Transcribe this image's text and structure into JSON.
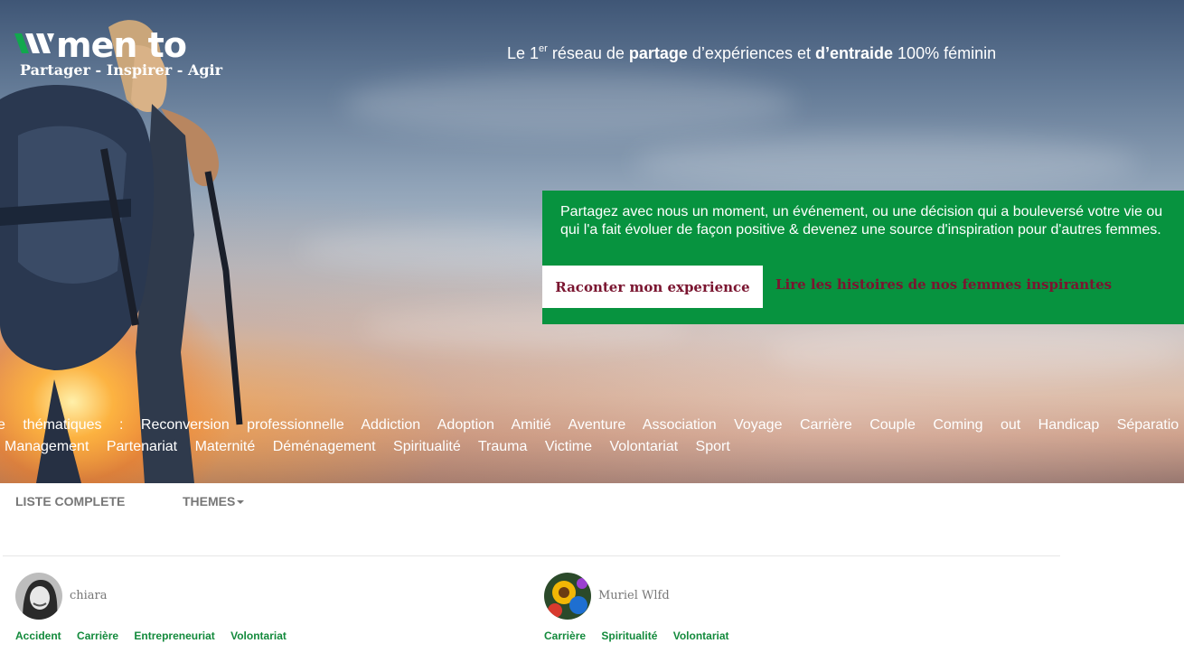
{
  "logo": {
    "wordmark": "men to",
    "tagline": "Partager - Inspirer - Agir"
  },
  "tagline": {
    "p1": "Le 1",
    "sup": "er",
    "p2": " réseau de ",
    "b1": "partage",
    "p3": " d’expériences et ",
    "b2": "d’entraide",
    "p4": " 100% féminin"
  },
  "cta": {
    "message": "Partagez avec nous un moment, un événement, ou une décision qui a bouleversé votre vie ou qui l'a fait évoluer de façon positive & devenez une source d'inspiration pour d'autres femmes.",
    "share_button": "Raconter mon experience",
    "read_link": "Lire les histoires de nos femmes inspirantes"
  },
  "themes_row1": [
    "e",
    "thématiques",
    ":",
    "Reconversion",
    "professionnelle",
    "Addiction",
    "Adoption",
    "Amitié",
    "Aventure",
    "Association",
    "Voyage",
    "Carrière",
    "Couple",
    "Coming",
    "out",
    "Handicap",
    "Séparatio"
  ],
  "themes_row2": [
    "Management",
    "Partenariat",
    "Maternité",
    "Déménagement",
    "Spiritualité",
    "Trauma",
    "Victime",
    "Volontariat",
    "Sport"
  ],
  "tabs": {
    "full_list": "LISTE COMPLETE",
    "themes": "THEMES"
  },
  "stories": [
    {
      "author": "chiara",
      "tags": [
        "Accident",
        "Carrière",
        "Entrepreneuriat",
        "Volontariat"
      ]
    },
    {
      "author": "Muriel Wlfd",
      "tags": [
        "Carrière",
        "Spiritualité",
        "Volontariat"
      ]
    }
  ],
  "colors": {
    "green": "#07933f",
    "burgundy": "#7a1530",
    "tag_green": "#138a3c"
  }
}
